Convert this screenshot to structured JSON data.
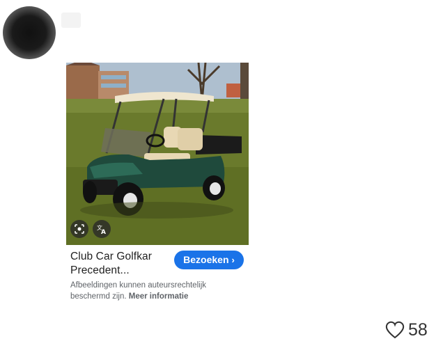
{
  "card": {
    "title_line1": "Club Car Golfkar",
    "title_line2": "Precedent...",
    "visit_label": "Bezoeken",
    "visit_chevron": "›",
    "note_text": "Afbeeldingen kunnen auteursrechtelijk beschermd zijn.",
    "note_link": "Meer informatie"
  },
  "likes": {
    "count": "58"
  },
  "colors": {
    "accent": "#1a73e8",
    "cart_body": "#1f4a3c",
    "seat": "#e8d8b4"
  },
  "icons": [
    "lens-icon",
    "translate-icon",
    "heart-icon"
  ]
}
